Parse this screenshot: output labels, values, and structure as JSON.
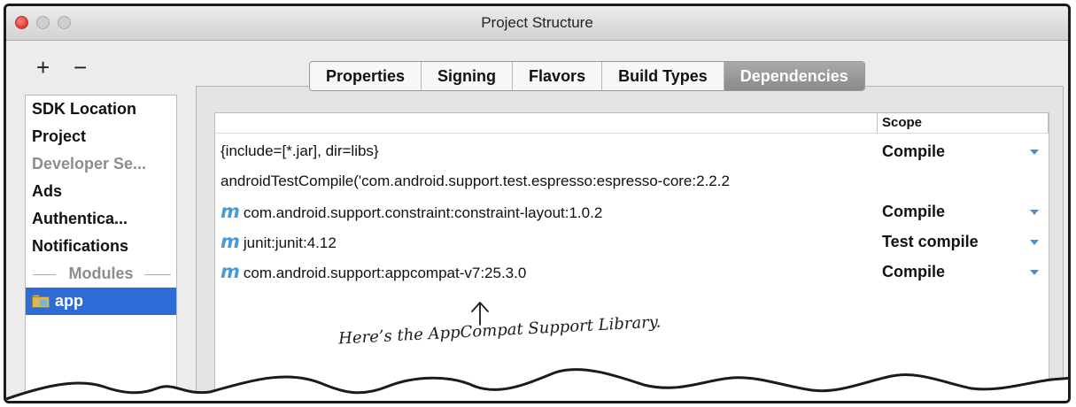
{
  "window": {
    "title": "Project Structure"
  },
  "toolbar": {
    "add": "+",
    "remove": "−"
  },
  "sidebar": {
    "items": [
      {
        "label": "SDK Location"
      },
      {
        "label": "Project"
      },
      {
        "label": "Developer Se..."
      },
      {
        "label": "Ads"
      },
      {
        "label": "Authentica..."
      },
      {
        "label": "Notifications"
      }
    ],
    "modules_header": "Modules",
    "modules": [
      {
        "label": "app",
        "icon": "module-folder-icon",
        "selected": true
      }
    ]
  },
  "tabs": [
    "Properties",
    "Signing",
    "Flavors",
    "Build Types",
    "Dependencies"
  ],
  "active_tab": "Dependencies",
  "table": {
    "scope_header": "Scope",
    "rows": [
      {
        "icon": "",
        "dependency": "{include=[*.jar], dir=libs}",
        "scope": "Compile"
      },
      {
        "icon": "",
        "dependency": "androidTestCompile('com.android.support.test.espresso:espresso-core:2.2.2",
        "scope": ""
      },
      {
        "icon": "m",
        "dependency": "com.android.support.constraint:constraint-layout:1.0.2",
        "scope": "Compile"
      },
      {
        "icon": "m",
        "dependency": "junit:junit:4.12",
        "scope": "Test compile"
      },
      {
        "icon": "m",
        "dependency": "com.android.support:appcompat-v7:25.3.0",
        "scope": "Compile"
      }
    ]
  },
  "annotation": "Here’s the AppCompat Support Library."
}
